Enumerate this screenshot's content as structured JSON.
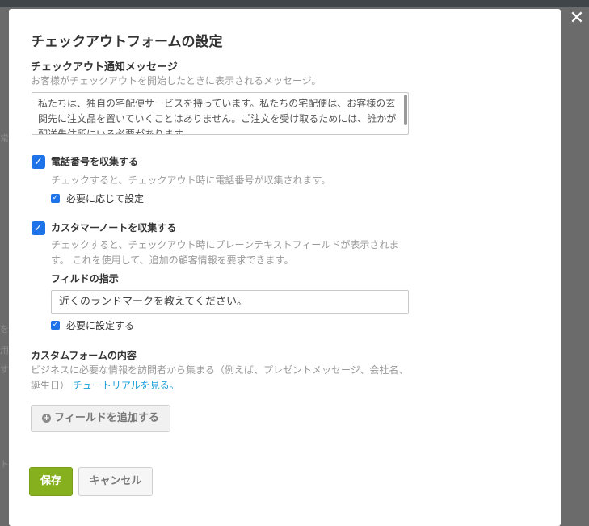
{
  "backdrop": {
    "fragments": [
      "常",
      "を",
      "用",
      "す",
      "ト"
    ]
  },
  "modal": {
    "close_label": "✕",
    "title": "チェックアウトフォームの設定",
    "notification": {
      "label": "チェックアウト通知メッセージ",
      "hint": "お客様がチェックアウトを開始したときに表示されるメッセージ。",
      "message": "私たちは、独自の宅配便サービスを持っています。私たちの宅配便は、お客様の玄関先に注文品を置いていくことはありません。ご注文を受け取るためには、誰かが配送先住所にいる必要があります。"
    },
    "phone": {
      "checked": true,
      "label": "電話番号を収集する",
      "hint": "チェックすると、チェックアウト時に電話番号が収集されます。",
      "sub_label": "必要に応じて設定",
      "sub_checked": true
    },
    "note": {
      "checked": true,
      "label": "カスタマーノートを収集する",
      "hint": "チェックすると、チェックアウト時にプレーンテキストフィールドが表示されます。 これを使用して、追加の顧客情報を要求できます。",
      "field_label": "フィルドの指示",
      "field_value": "近くのランドマークを教えてください。",
      "required_label": "必要に設定する",
      "required_checked": true
    },
    "custom": {
      "label": "カスタムフォームの内容",
      "hint": "ビジネスに必要な情報を訪問者から集まる（例えば、プレゼントメッセージ、会社名、誕生日）",
      "link": "チュートリアルを見る。",
      "add_button": "フィールドを追加する"
    },
    "actions": {
      "save": "保存",
      "cancel": "キャンセル"
    }
  },
  "colors": {
    "accent_blue": "#1e73e8",
    "save_green": "#86b01e",
    "link": "#1a9fd6"
  }
}
